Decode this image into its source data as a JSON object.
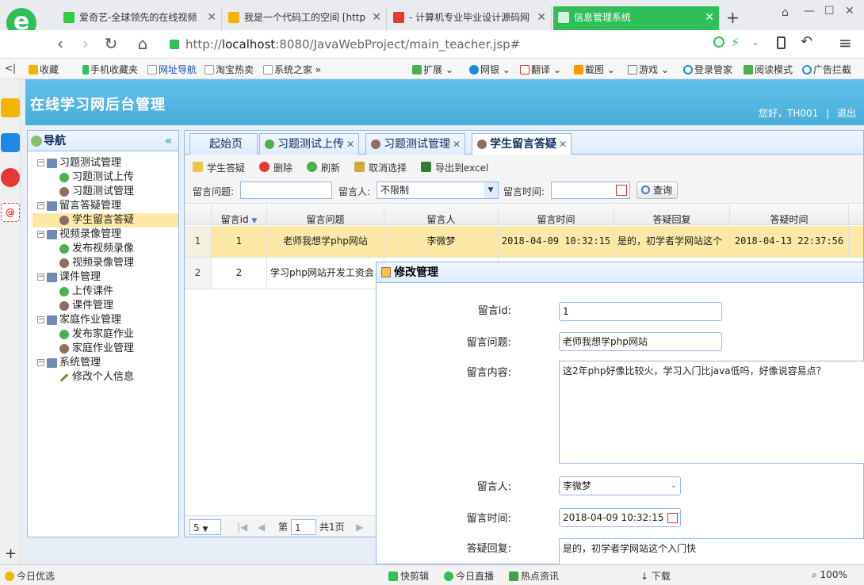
{
  "browser": {
    "tabs": [
      {
        "title": "爱奇艺-全球领先的在线视频",
        "color": "#2ecc40"
      },
      {
        "title": "我是一个代码工的空间 [http",
        "color": "#f5b400"
      },
      {
        "title": "- 计算机专业毕业设计源码网",
        "color": "#e53935"
      },
      {
        "title": "信息管理系统",
        "color": "#ffffff"
      }
    ],
    "new_tab": "+",
    "url_prefix": "http://",
    "url_host": "localhost",
    "url_rest": ":8080/JavaWebProject/main_teacher.jsp#",
    "bookmarks": [
      "收藏",
      "手机收藏夹",
      "网址导航",
      "淘宝热卖",
      "系统之家",
      "扩展",
      "网银",
      "翻译",
      "截图",
      "游戏",
      "登录管家",
      "阅读模式",
      "广告拦截"
    ]
  },
  "header": {
    "title": "在线学习网后台管理",
    "greeting": "您好，TH001",
    "separator": "|",
    "logout": "退出"
  },
  "nav": {
    "title": "导航",
    "collapse": "«",
    "tree": [
      {
        "label": "习题测试管理",
        "level": 1
      },
      {
        "label": "习题测试上传",
        "level": 2,
        "icon": "add"
      },
      {
        "label": "习题测试管理",
        "level": 2,
        "icon": "user"
      },
      {
        "label": "留言答疑管理",
        "level": 1
      },
      {
        "label": "学生留言答疑",
        "level": 2,
        "icon": "user",
        "selected": true
      },
      {
        "label": "视频录像管理",
        "level": 1
      },
      {
        "label": "发布视频录像",
        "level": 2,
        "icon": "add"
      },
      {
        "label": "视频录像管理",
        "level": 2,
        "icon": "user"
      },
      {
        "label": "课件管理",
        "level": 1
      },
      {
        "label": "上传课件",
        "level": 2,
        "icon": "add"
      },
      {
        "label": "课件管理",
        "level": 2,
        "icon": "user"
      },
      {
        "label": "家庭作业管理",
        "level": 1
      },
      {
        "label": "发布家庭作业",
        "level": 2,
        "icon": "add"
      },
      {
        "label": "家庭作业管理",
        "level": 2,
        "icon": "user"
      },
      {
        "label": "系统管理",
        "level": 1
      },
      {
        "label": "修改个人信息",
        "level": 2,
        "icon": "pen"
      }
    ]
  },
  "main_tabs": [
    {
      "label": "起始页",
      "closable": false
    },
    {
      "label": "习题测试上传",
      "closable": true
    },
    {
      "label": "习题测试管理",
      "closable": true
    },
    {
      "label": "学生留言答疑",
      "closable": true,
      "active": true
    }
  ],
  "toolbar": {
    "answer": "学生答疑",
    "delete": "删除",
    "refresh": "刷新",
    "cancel_select": "取消选择",
    "export": "导出到excel"
  },
  "filter": {
    "question_label": "留言问题:",
    "question_value": "",
    "person_label": "留言人:",
    "person_value": "不限制",
    "time_label": "留言时间:",
    "time_value": "",
    "query": "查询"
  },
  "grid": {
    "columns": [
      "留言id",
      "留言问题",
      "留言人",
      "留言时间",
      "答疑回复",
      "答疑时间"
    ],
    "rows": [
      {
        "rownum": "1",
        "id": "1",
        "question": "老师我想学php网站",
        "person": "李微梦",
        "time": "2018-04-09 10:32:15",
        "reply": "是的，初学者学网站这个",
        "reply_time": "2018-04-13 22:37:56"
      },
      {
        "rownum": "2",
        "id": "2",
        "question": "学习php网站开发工资会",
        "person": "",
        "time": "",
        "reply": "",
        "reply_time": ""
      }
    ]
  },
  "pager": {
    "page_size": "5",
    "page_prefix": "第",
    "page_value": "1",
    "page_suffix": "共1页"
  },
  "dialog": {
    "title": "修改管理",
    "id_label": "留言id:",
    "id_value": "1",
    "question_label": "留言问题:",
    "question_value": "老师我想学php网站",
    "content_label": "留言内容:",
    "content_value": "这2年php好像比较火，学习入门比java低吗，好像说容易点？",
    "person_label": "留言人:",
    "person_value": "李微梦",
    "time_label": "留言时间:",
    "time_value": "2018-04-09 10:32:15",
    "reply_label": "答疑回复:",
    "reply_value": "是的，初学者学网站这个入门快"
  },
  "statusbar": {
    "left": "今日优选",
    "items": [
      "快剪辑",
      "今日直播",
      "热点资讯",
      "下载"
    ],
    "zoom": "100%"
  }
}
